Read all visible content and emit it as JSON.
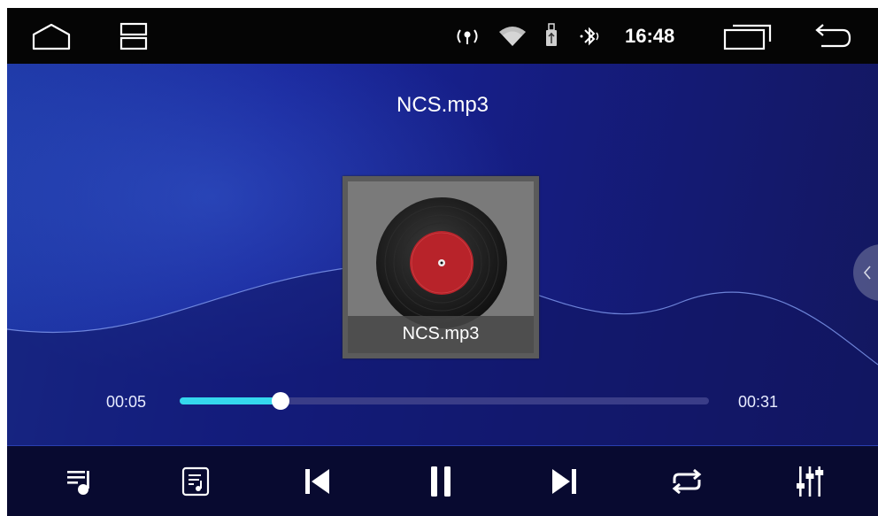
{
  "status_bar": {
    "clock": "16:48",
    "icons": [
      "home-icon",
      "split-screen-icon",
      "hotspot-icon",
      "wifi-icon",
      "usb-icon",
      "bluetooth-icon",
      "recent-apps-icon",
      "back-icon"
    ]
  },
  "player": {
    "title": "NCS.mp3",
    "album_caption": "NCS.mp3",
    "elapsed": "00:05",
    "duration": "00:31",
    "progress_fraction": 0.19,
    "state": "playing"
  },
  "controls": [
    "playlist-icon",
    "lyrics-icon",
    "previous-icon",
    "pause-icon",
    "next-icon",
    "repeat-icon",
    "equalizer-icon"
  ],
  "colors": {
    "accent": "#35d8ee",
    "background": "#151c7e",
    "status_bar": "#050505",
    "control_bar": "#080a30"
  }
}
